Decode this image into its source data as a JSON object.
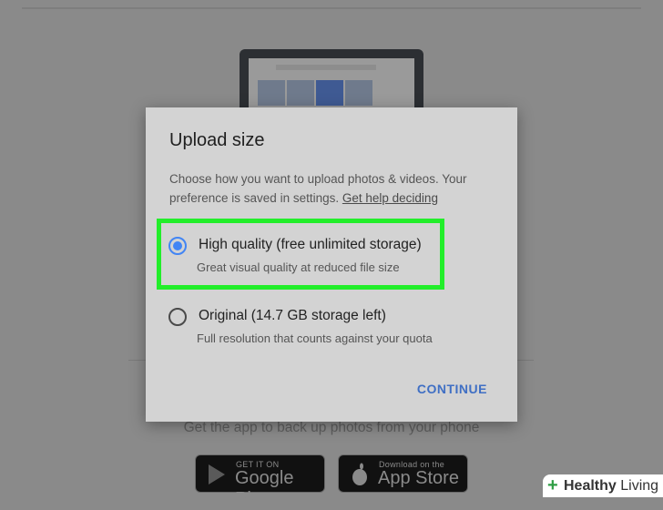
{
  "background": {
    "tagline": "Get the app to back up photos from your phone",
    "google_play": {
      "small": "GET IT ON",
      "big": "Google Play"
    },
    "app_store": {
      "small": "Download on the",
      "big": "App Store"
    }
  },
  "dialog": {
    "title": "Upload size",
    "description": "Choose how you want to upload photos & videos. Your preference is saved in settings.",
    "help_link": "Get help deciding",
    "options": [
      {
        "label": "High quality (free unlimited storage)",
        "sublabel": "Great visual quality at reduced file size",
        "selected": true
      },
      {
        "label": "Original (14.7 GB storage left)",
        "sublabel": "Full resolution that counts against your quota",
        "selected": false
      }
    ],
    "continue_label": "CONTINUE"
  },
  "watermark": {
    "brand_bold": "Healthy",
    "brand_rest": " Living"
  },
  "colors": {
    "accent": "#4285f4",
    "highlight": "#22ee2a",
    "continue": "#3f6fc4"
  }
}
